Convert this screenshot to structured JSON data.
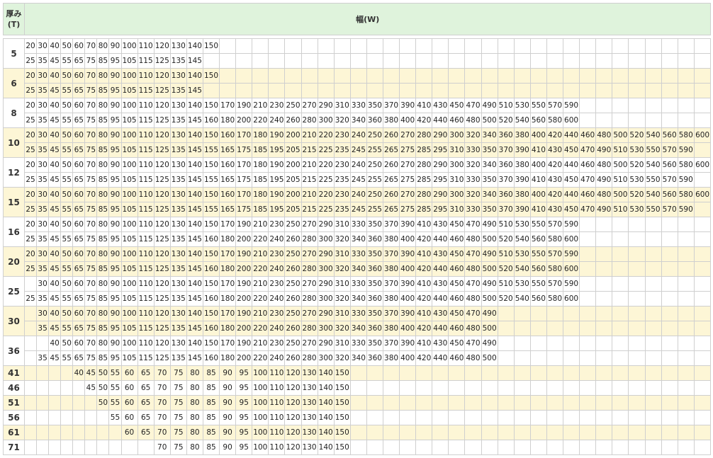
{
  "header": {
    "thickness_label": "厚み",
    "thickness_unit": "(T)",
    "width_label": "幅(W)"
  },
  "table": {
    "groups": [
      {
        "t": "5",
        "alt": false,
        "rows": [
          [
            20,
            30,
            40,
            50,
            60,
            70,
            80,
            90,
            100,
            110,
            120,
            130,
            140,
            150
          ],
          [
            25,
            35,
            45,
            55,
            65,
            75,
            85,
            95,
            105,
            115,
            125,
            135,
            145
          ]
        ],
        "offset": 0
      },
      {
        "t": "6",
        "alt": true,
        "rows": [
          [
            20,
            30,
            40,
            50,
            60,
            70,
            80,
            90,
            100,
            110,
            120,
            130,
            140,
            150
          ],
          [
            25,
            35,
            45,
            55,
            65,
            75,
            85,
            95,
            105,
            115,
            125,
            135,
            145
          ]
        ],
        "offset": 0
      },
      {
        "t": "8",
        "alt": false,
        "rows": [
          [
            20,
            30,
            40,
            50,
            60,
            70,
            80,
            90,
            100,
            110,
            120,
            130,
            140,
            150,
            170,
            190,
            210,
            230,
            250,
            270,
            290,
            310,
            330,
            350,
            370,
            390,
            410,
            430,
            450,
            470,
            490,
            510,
            530,
            550,
            570,
            590
          ],
          [
            25,
            35,
            45,
            55,
            65,
            75,
            85,
            95,
            105,
            115,
            125,
            135,
            145,
            160,
            180,
            200,
            220,
            240,
            260,
            280,
            300,
            320,
            340,
            360,
            380,
            400,
            420,
            440,
            460,
            480,
            500,
            520,
            540,
            560,
            580,
            600
          ]
        ],
        "offset": 0
      },
      {
        "t": "10",
        "alt": true,
        "rows": [
          [
            20,
            30,
            40,
            50,
            60,
            70,
            80,
            90,
            100,
            110,
            120,
            130,
            140,
            150,
            160,
            170,
            180,
            190,
            200,
            210,
            220,
            230,
            240,
            250,
            260,
            270,
            280,
            290,
            300,
            320,
            340,
            360,
            380,
            400,
            420,
            440,
            460,
            480,
            500,
            520,
            540,
            560,
            580,
            600
          ],
          [
            25,
            35,
            45,
            55,
            65,
            75,
            85,
            95,
            105,
            115,
            125,
            135,
            145,
            155,
            165,
            175,
            185,
            195,
            205,
            215,
            225,
            235,
            245,
            255,
            265,
            275,
            285,
            295,
            310,
            330,
            350,
            370,
            390,
            410,
            430,
            450,
            470,
            490,
            510,
            530,
            550,
            570,
            590
          ]
        ],
        "offset": 0
      },
      {
        "t": "12",
        "alt": false,
        "rows": [
          [
            20,
            30,
            40,
            50,
            60,
            70,
            80,
            90,
            100,
            110,
            120,
            130,
            140,
            150,
            160,
            170,
            180,
            190,
            200,
            210,
            220,
            230,
            240,
            250,
            260,
            270,
            280,
            290,
            300,
            320,
            340,
            360,
            380,
            400,
            420,
            440,
            460,
            480,
            500,
            520,
            540,
            560,
            580,
            600
          ],
          [
            25,
            35,
            45,
            55,
            65,
            75,
            85,
            95,
            105,
            115,
            125,
            135,
            145,
            155,
            165,
            175,
            185,
            195,
            205,
            215,
            225,
            235,
            245,
            255,
            265,
            275,
            285,
            295,
            310,
            330,
            350,
            370,
            390,
            410,
            430,
            450,
            470,
            490,
            510,
            530,
            550,
            570,
            590
          ]
        ],
        "offset": 0
      },
      {
        "t": "15",
        "alt": true,
        "rows": [
          [
            20,
            30,
            40,
            50,
            60,
            70,
            80,
            90,
            100,
            110,
            120,
            130,
            140,
            150,
            160,
            170,
            180,
            190,
            200,
            210,
            220,
            230,
            240,
            250,
            260,
            270,
            280,
            290,
            300,
            320,
            340,
            360,
            380,
            400,
            420,
            440,
            460,
            480,
            500,
            520,
            540,
            560,
            580,
            600
          ],
          [
            25,
            35,
            45,
            55,
            65,
            75,
            85,
            95,
            105,
            115,
            125,
            135,
            145,
            155,
            165,
            175,
            185,
            195,
            205,
            215,
            225,
            235,
            245,
            255,
            265,
            275,
            285,
            295,
            310,
            330,
            350,
            370,
            390,
            410,
            430,
            450,
            470,
            490,
            510,
            530,
            550,
            570,
            590
          ]
        ],
        "offset": 0
      },
      {
        "t": "16",
        "alt": false,
        "rows": [
          [
            20,
            30,
            40,
            50,
            60,
            70,
            80,
            90,
            100,
            110,
            120,
            130,
            140,
            150,
            170,
            190,
            210,
            230,
            250,
            270,
            290,
            310,
            330,
            350,
            370,
            390,
            410,
            430,
            450,
            470,
            490,
            510,
            530,
            550,
            570,
            590
          ],
          [
            25,
            35,
            45,
            55,
            65,
            75,
            85,
            95,
            105,
            115,
            125,
            135,
            145,
            160,
            180,
            200,
            220,
            240,
            260,
            280,
            300,
            320,
            340,
            360,
            380,
            400,
            420,
            440,
            460,
            480,
            500,
            520,
            540,
            560,
            580,
            600
          ]
        ],
        "offset": 0
      },
      {
        "t": "20",
        "alt": true,
        "rows": [
          [
            20,
            30,
            40,
            50,
            60,
            70,
            80,
            90,
            100,
            110,
            120,
            130,
            140,
            150,
            170,
            190,
            210,
            230,
            250,
            270,
            290,
            310,
            330,
            350,
            370,
            390,
            410,
            430,
            450,
            470,
            490,
            510,
            530,
            550,
            570,
            590
          ],
          [
            25,
            35,
            45,
            55,
            65,
            75,
            85,
            95,
            105,
            115,
            125,
            135,
            145,
            160,
            180,
            200,
            220,
            240,
            260,
            280,
            300,
            320,
            340,
            360,
            380,
            400,
            420,
            440,
            460,
            480,
            500,
            520,
            540,
            560,
            580,
            600
          ]
        ],
        "offset": 0
      },
      {
        "t": "25",
        "alt": false,
        "rows": [
          [
            null,
            30,
            40,
            50,
            60,
            70,
            80,
            90,
            100,
            110,
            120,
            130,
            140,
            150,
            170,
            190,
            210,
            230,
            250,
            270,
            290,
            310,
            330,
            350,
            370,
            390,
            410,
            430,
            450,
            470,
            490,
            510,
            530,
            550,
            570,
            590
          ],
          [
            25,
            35,
            45,
            55,
            65,
            75,
            85,
            95,
            105,
            115,
            125,
            135,
            145,
            160,
            180,
            200,
            220,
            240,
            260,
            280,
            300,
            320,
            340,
            360,
            380,
            400,
            420,
            440,
            460,
            480,
            500,
            520,
            540,
            560,
            580,
            600
          ]
        ],
        "offset": 0
      },
      {
        "t": "30",
        "alt": true,
        "rows": [
          [
            null,
            30,
            40,
            50,
            60,
            70,
            80,
            90,
            100,
            110,
            120,
            130,
            140,
            150,
            170,
            190,
            210,
            230,
            250,
            270,
            290,
            310,
            330,
            350,
            370,
            390,
            410,
            430,
            450,
            470,
            490
          ],
          [
            null,
            35,
            45,
            55,
            65,
            75,
            85,
            95,
            105,
            115,
            125,
            135,
            145,
            160,
            180,
            200,
            220,
            240,
            260,
            280,
            300,
            320,
            340,
            360,
            380,
            400,
            420,
            440,
            460,
            480,
            500
          ]
        ],
        "offset": 0
      },
      {
        "t": "36",
        "alt": false,
        "rows": [
          [
            null,
            null,
            40,
            50,
            60,
            70,
            80,
            90,
            100,
            110,
            120,
            130,
            140,
            150,
            170,
            190,
            210,
            230,
            250,
            270,
            290,
            310,
            330,
            350,
            370,
            390,
            410,
            430,
            450,
            470,
            490
          ],
          [
            null,
            35,
            45,
            55,
            65,
            75,
            85,
            95,
            105,
            115,
            125,
            135,
            145,
            160,
            180,
            200,
            220,
            240,
            260,
            280,
            300,
            320,
            340,
            360,
            380,
            400,
            420,
            440,
            460,
            480,
            500
          ]
        ],
        "offset": 0
      }
    ],
    "singles": [
      {
        "t": "41",
        "alt": true,
        "row": [
          null,
          null,
          null,
          null,
          40,
          45,
          50,
          55,
          60,
          65,
          70,
          75,
          80,
          85,
          90,
          95,
          100,
          110,
          120,
          130,
          140,
          150
        ]
      },
      {
        "t": "46",
        "alt": false,
        "row": [
          null,
          null,
          null,
          null,
          null,
          45,
          50,
          55,
          60,
          65,
          70,
          75,
          80,
          85,
          90,
          95,
          100,
          110,
          120,
          130,
          140,
          150
        ]
      },
      {
        "t": "51",
        "alt": true,
        "row": [
          null,
          null,
          null,
          null,
          null,
          null,
          50,
          55,
          60,
          65,
          70,
          75,
          80,
          85,
          90,
          95,
          100,
          110,
          120,
          130,
          140,
          150
        ]
      },
      {
        "t": "56",
        "alt": false,
        "row": [
          null,
          null,
          null,
          null,
          null,
          null,
          null,
          55,
          60,
          65,
          70,
          75,
          80,
          85,
          90,
          95,
          100,
          110,
          120,
          130,
          140,
          150
        ]
      },
      {
        "t": "61",
        "alt": true,
        "row": [
          null,
          null,
          null,
          null,
          null,
          null,
          null,
          null,
          60,
          65,
          70,
          75,
          80,
          85,
          90,
          95,
          100,
          110,
          120,
          130,
          140,
          150
        ]
      },
      {
        "t": "71",
        "alt": false,
        "row": [
          null,
          null,
          null,
          null,
          null,
          null,
          null,
          null,
          null,
          null,
          70,
          75,
          80,
          85,
          90,
          95,
          100,
          110,
          120,
          130,
          140,
          150
        ]
      }
    ]
  }
}
